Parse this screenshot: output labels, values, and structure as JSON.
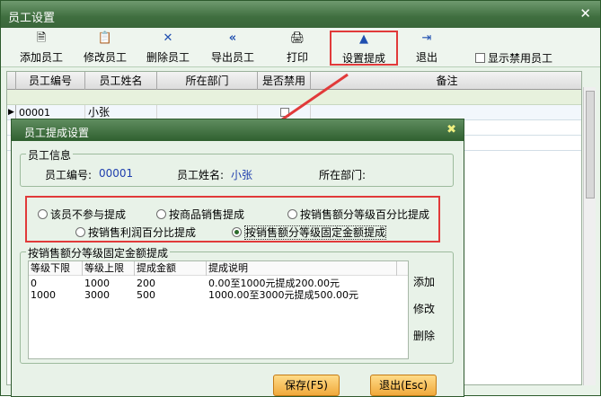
{
  "window": {
    "title": "员工设置",
    "close": "✕"
  },
  "toolbar": {
    "add": "添加员工",
    "edit": "修改员工",
    "delete": "删除员工",
    "export": "导出员工",
    "print": "打印",
    "commission": "设置提成",
    "exit": "退出"
  },
  "show_disabled": "显示禁用员工",
  "grid": {
    "headers": [
      "员工编号",
      "员工姓名",
      "所在部门",
      "是否禁用",
      "备注"
    ],
    "rows": [
      {
        "id": "00001",
        "name": "小张",
        "dept": "",
        "disabled": false,
        "note": ""
      }
    ]
  },
  "dialog": {
    "title": "员工提成设置",
    "close": "✖",
    "info_group": "员工信息",
    "emp_no_label": "员工编号:",
    "emp_no": "00001",
    "emp_name_label": "员工姓名:",
    "emp_name": "小张",
    "dept_label": "所在部门:",
    "options": [
      "该员不参与提成",
      "按商品销售提成",
      "按销售额分等级百分比提成",
      "按销售利润百分比提成",
      "按销售额分等级固定金额提成"
    ],
    "selected_option": 4,
    "table_group": "按销售额分等级固定金额提成",
    "table": {
      "headers": [
        "等级下限",
        "等级上限",
        "提成金额",
        "提成说明"
      ],
      "rows": [
        [
          "0",
          "1000",
          "200",
          "0.00至1000元提成200.00元"
        ],
        [
          "1000",
          "3000",
          "500",
          "1000.00至3000元提成500.00元"
        ]
      ]
    },
    "side_add": "添加",
    "side_edit": "修改",
    "side_delete": "删除",
    "save": "保存(F5)",
    "cancel": "退出(Esc)"
  }
}
